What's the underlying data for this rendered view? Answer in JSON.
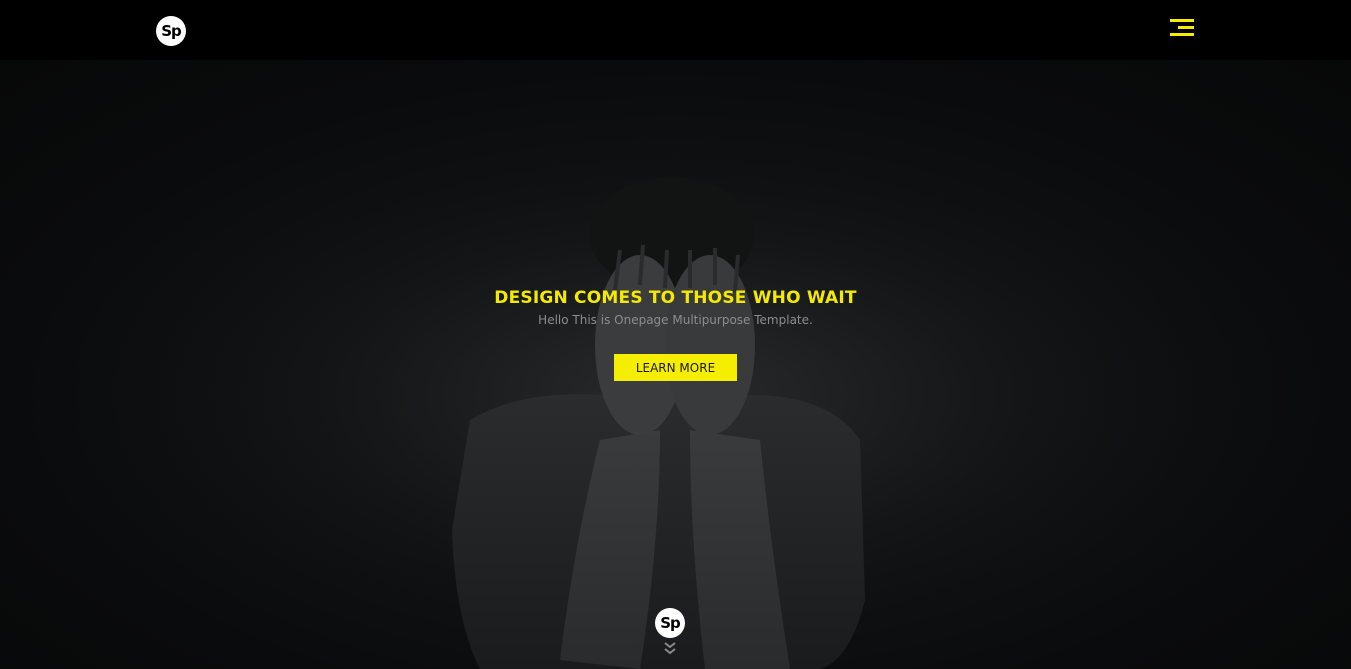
{
  "header": {
    "logo_text": "Sp",
    "menu_icon": "hamburger-menu-icon"
  },
  "hero": {
    "headline": "DESIGN COMES TO THOSE WHO WAIT",
    "subheadline": "Hello This is Onepage Multipurpose Template.",
    "cta_label": "LEARN MORE",
    "scroll_logo_text": "Sp",
    "scroll_icon": "double-chevron-down-icon"
  },
  "colors": {
    "accent": "#f5ee00",
    "navbar_bg": "#000000",
    "hero_bg": "#0a0b0c"
  }
}
